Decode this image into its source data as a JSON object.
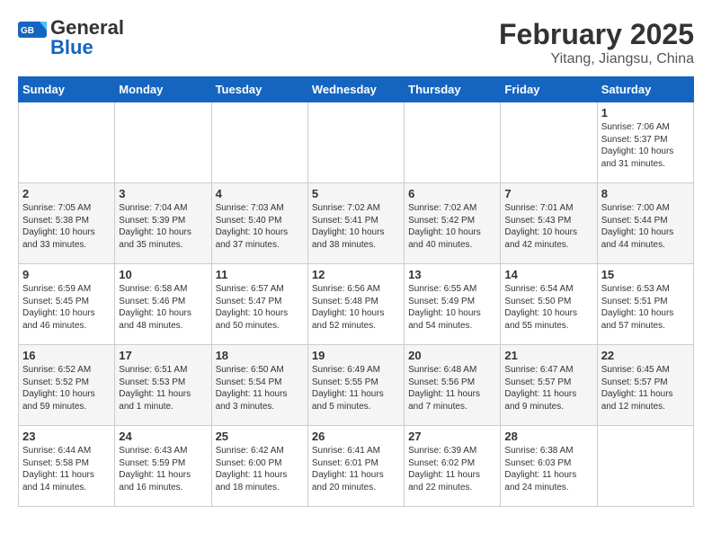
{
  "header": {
    "logo_general": "General",
    "logo_blue": "Blue",
    "main_title": "February 2025",
    "subtitle": "Yitang, Jiangsu, China"
  },
  "days_of_week": [
    "Sunday",
    "Monday",
    "Tuesday",
    "Wednesday",
    "Thursday",
    "Friday",
    "Saturday"
  ],
  "weeks": [
    [
      {
        "num": "",
        "info": ""
      },
      {
        "num": "",
        "info": ""
      },
      {
        "num": "",
        "info": ""
      },
      {
        "num": "",
        "info": ""
      },
      {
        "num": "",
        "info": ""
      },
      {
        "num": "",
        "info": ""
      },
      {
        "num": "1",
        "info": "Sunrise: 7:06 AM\nSunset: 5:37 PM\nDaylight: 10 hours and 31 minutes."
      }
    ],
    [
      {
        "num": "2",
        "info": "Sunrise: 7:05 AM\nSunset: 5:38 PM\nDaylight: 10 hours and 33 minutes."
      },
      {
        "num": "3",
        "info": "Sunrise: 7:04 AM\nSunset: 5:39 PM\nDaylight: 10 hours and 35 minutes."
      },
      {
        "num": "4",
        "info": "Sunrise: 7:03 AM\nSunset: 5:40 PM\nDaylight: 10 hours and 37 minutes."
      },
      {
        "num": "5",
        "info": "Sunrise: 7:02 AM\nSunset: 5:41 PM\nDaylight: 10 hours and 38 minutes."
      },
      {
        "num": "6",
        "info": "Sunrise: 7:02 AM\nSunset: 5:42 PM\nDaylight: 10 hours and 40 minutes."
      },
      {
        "num": "7",
        "info": "Sunrise: 7:01 AM\nSunset: 5:43 PM\nDaylight: 10 hours and 42 minutes."
      },
      {
        "num": "8",
        "info": "Sunrise: 7:00 AM\nSunset: 5:44 PM\nDaylight: 10 hours and 44 minutes."
      }
    ],
    [
      {
        "num": "9",
        "info": "Sunrise: 6:59 AM\nSunset: 5:45 PM\nDaylight: 10 hours and 46 minutes."
      },
      {
        "num": "10",
        "info": "Sunrise: 6:58 AM\nSunset: 5:46 PM\nDaylight: 10 hours and 48 minutes."
      },
      {
        "num": "11",
        "info": "Sunrise: 6:57 AM\nSunset: 5:47 PM\nDaylight: 10 hours and 50 minutes."
      },
      {
        "num": "12",
        "info": "Sunrise: 6:56 AM\nSunset: 5:48 PM\nDaylight: 10 hours and 52 minutes."
      },
      {
        "num": "13",
        "info": "Sunrise: 6:55 AM\nSunset: 5:49 PM\nDaylight: 10 hours and 54 minutes."
      },
      {
        "num": "14",
        "info": "Sunrise: 6:54 AM\nSunset: 5:50 PM\nDaylight: 10 hours and 55 minutes."
      },
      {
        "num": "15",
        "info": "Sunrise: 6:53 AM\nSunset: 5:51 PM\nDaylight: 10 hours and 57 minutes."
      }
    ],
    [
      {
        "num": "16",
        "info": "Sunrise: 6:52 AM\nSunset: 5:52 PM\nDaylight: 10 hours and 59 minutes."
      },
      {
        "num": "17",
        "info": "Sunrise: 6:51 AM\nSunset: 5:53 PM\nDaylight: 11 hours and 1 minute."
      },
      {
        "num": "18",
        "info": "Sunrise: 6:50 AM\nSunset: 5:54 PM\nDaylight: 11 hours and 3 minutes."
      },
      {
        "num": "19",
        "info": "Sunrise: 6:49 AM\nSunset: 5:55 PM\nDaylight: 11 hours and 5 minutes."
      },
      {
        "num": "20",
        "info": "Sunrise: 6:48 AM\nSunset: 5:56 PM\nDaylight: 11 hours and 7 minutes."
      },
      {
        "num": "21",
        "info": "Sunrise: 6:47 AM\nSunset: 5:57 PM\nDaylight: 11 hours and 9 minutes."
      },
      {
        "num": "22",
        "info": "Sunrise: 6:45 AM\nSunset: 5:57 PM\nDaylight: 11 hours and 12 minutes."
      }
    ],
    [
      {
        "num": "23",
        "info": "Sunrise: 6:44 AM\nSunset: 5:58 PM\nDaylight: 11 hours and 14 minutes."
      },
      {
        "num": "24",
        "info": "Sunrise: 6:43 AM\nSunset: 5:59 PM\nDaylight: 11 hours and 16 minutes."
      },
      {
        "num": "25",
        "info": "Sunrise: 6:42 AM\nSunset: 6:00 PM\nDaylight: 11 hours and 18 minutes."
      },
      {
        "num": "26",
        "info": "Sunrise: 6:41 AM\nSunset: 6:01 PM\nDaylight: 11 hours and 20 minutes."
      },
      {
        "num": "27",
        "info": "Sunrise: 6:39 AM\nSunset: 6:02 PM\nDaylight: 11 hours and 22 minutes."
      },
      {
        "num": "28",
        "info": "Sunrise: 6:38 AM\nSunset: 6:03 PM\nDaylight: 11 hours and 24 minutes."
      },
      {
        "num": "",
        "info": ""
      }
    ]
  ]
}
